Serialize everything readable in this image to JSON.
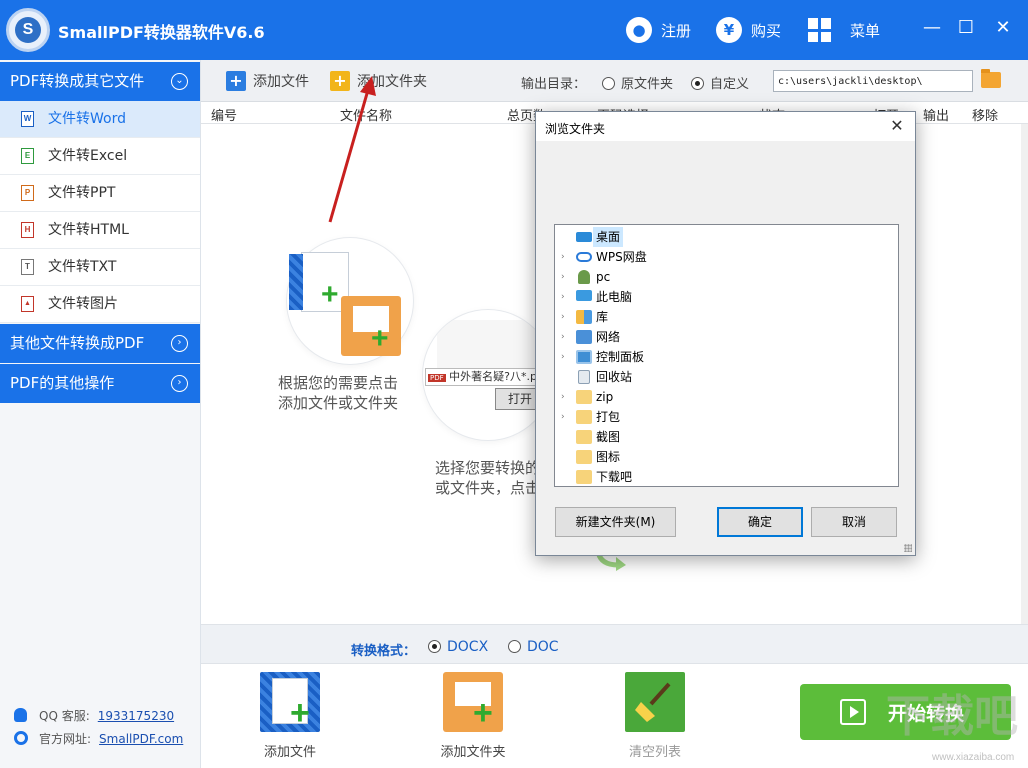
{
  "app": {
    "title": "SmallPDF转换器软件V6.6",
    "logo_letter": "S",
    "accent_color": "#1a72e8"
  },
  "titlebar": {
    "register_label": "注册",
    "buy_label": "购买",
    "menu_label": "菜单",
    "buy_symbol": "¥",
    "minimize_symbol": "—",
    "maximize_symbol": "☐",
    "close_symbol": "✕"
  },
  "sidebar": {
    "sections": [
      {
        "label": "PDF转换成其它文件",
        "expanded": true
      },
      {
        "label": "其他文件转换成PDF",
        "expanded": false
      },
      {
        "label": "PDF的其他操作",
        "expanded": false
      }
    ],
    "items": [
      {
        "label": "文件转Word",
        "icon": "W",
        "active": true
      },
      {
        "label": "文件转Excel",
        "icon": "E",
        "active": false
      },
      {
        "label": "文件转PPT",
        "icon": "P",
        "active": false
      },
      {
        "label": "文件转HTML",
        "icon": "H",
        "active": false
      },
      {
        "label": "文件转TXT",
        "icon": "T",
        "active": false
      },
      {
        "label": "文件转图片",
        "icon": "▲",
        "active": false
      }
    ],
    "footer": {
      "qq_label": "QQ 客服:",
      "qq_number": "1933175230",
      "site_label": "官方网址:",
      "site_url": "SmallPDF.com"
    }
  },
  "toolbar": {
    "add_file_label": "添加文件",
    "add_folder_label": "添加文件夹",
    "output_dir_label": "输出目录：",
    "option_source_dir": "原文件夹",
    "option_custom": "自定义",
    "selected_option": "自定义",
    "output_path": "c:\\users\\jackli\\desktop\\"
  },
  "file_list": {
    "columns": [
      "编号",
      "文件名称",
      "总页数",
      "页码选择",
      "状态",
      "打开",
      "输出",
      "移除"
    ],
    "rows": []
  },
  "guide": {
    "step1_line1": "根据您的需要点击",
    "step1_line2": "添加文件或文件夹",
    "step2_line1": "选择您要转换的",
    "step2_line2": "或文件夹，点击",
    "zoom_file_name": "中外著名疑?八*.pd",
    "zoom_button": "打开",
    "pdf_badge": "PDF"
  },
  "format": {
    "label": "转换格式：",
    "options": [
      "DOCX",
      "DOC"
    ],
    "selected": "DOCX"
  },
  "bottom": {
    "add_file_label": "添加文件",
    "add_folder_label": "添加文件夹",
    "clear_list_label": "清空列表",
    "start_label": "开始转换"
  },
  "dialog": {
    "title": "浏览文件夹",
    "tree": [
      {
        "label": "桌面",
        "icon": "desktop-icon",
        "expandable": false,
        "selected": true
      },
      {
        "label": "WPS网盘",
        "icon": "cloud-icon",
        "expandable": true,
        "selected": false
      },
      {
        "label": "pc",
        "icon": "user-icon",
        "expandable": true,
        "selected": false
      },
      {
        "label": "此电脑",
        "icon": "computer-icon",
        "expandable": true,
        "selected": false
      },
      {
        "label": "库",
        "icon": "library-icon",
        "expandable": true,
        "selected": false
      },
      {
        "label": "网络",
        "icon": "network-icon",
        "expandable": true,
        "selected": false
      },
      {
        "label": "控制面板",
        "icon": "control-panel-icon",
        "expandable": true,
        "selected": false
      },
      {
        "label": "回收站",
        "icon": "recycle-bin-icon",
        "expandable": false,
        "selected": false
      },
      {
        "label": "zip",
        "icon": "folder-icon",
        "expandable": true,
        "selected": false
      },
      {
        "label": "打包",
        "icon": "folder-icon",
        "expandable": true,
        "selected": false
      },
      {
        "label": "截图",
        "icon": "folder-icon",
        "expandable": false,
        "selected": false
      },
      {
        "label": "图标",
        "icon": "folder-icon",
        "expandable": false,
        "selected": false
      },
      {
        "label": "下载吧",
        "icon": "folder-icon",
        "expandable": false,
        "selected": false
      }
    ],
    "new_folder_label": "新建文件夹(M)",
    "ok_label": "确定",
    "cancel_label": "取消",
    "close_symbol": "✕"
  },
  "watermark": {
    "text": "下载吧",
    "url": "www.xiazaiba.com"
  }
}
